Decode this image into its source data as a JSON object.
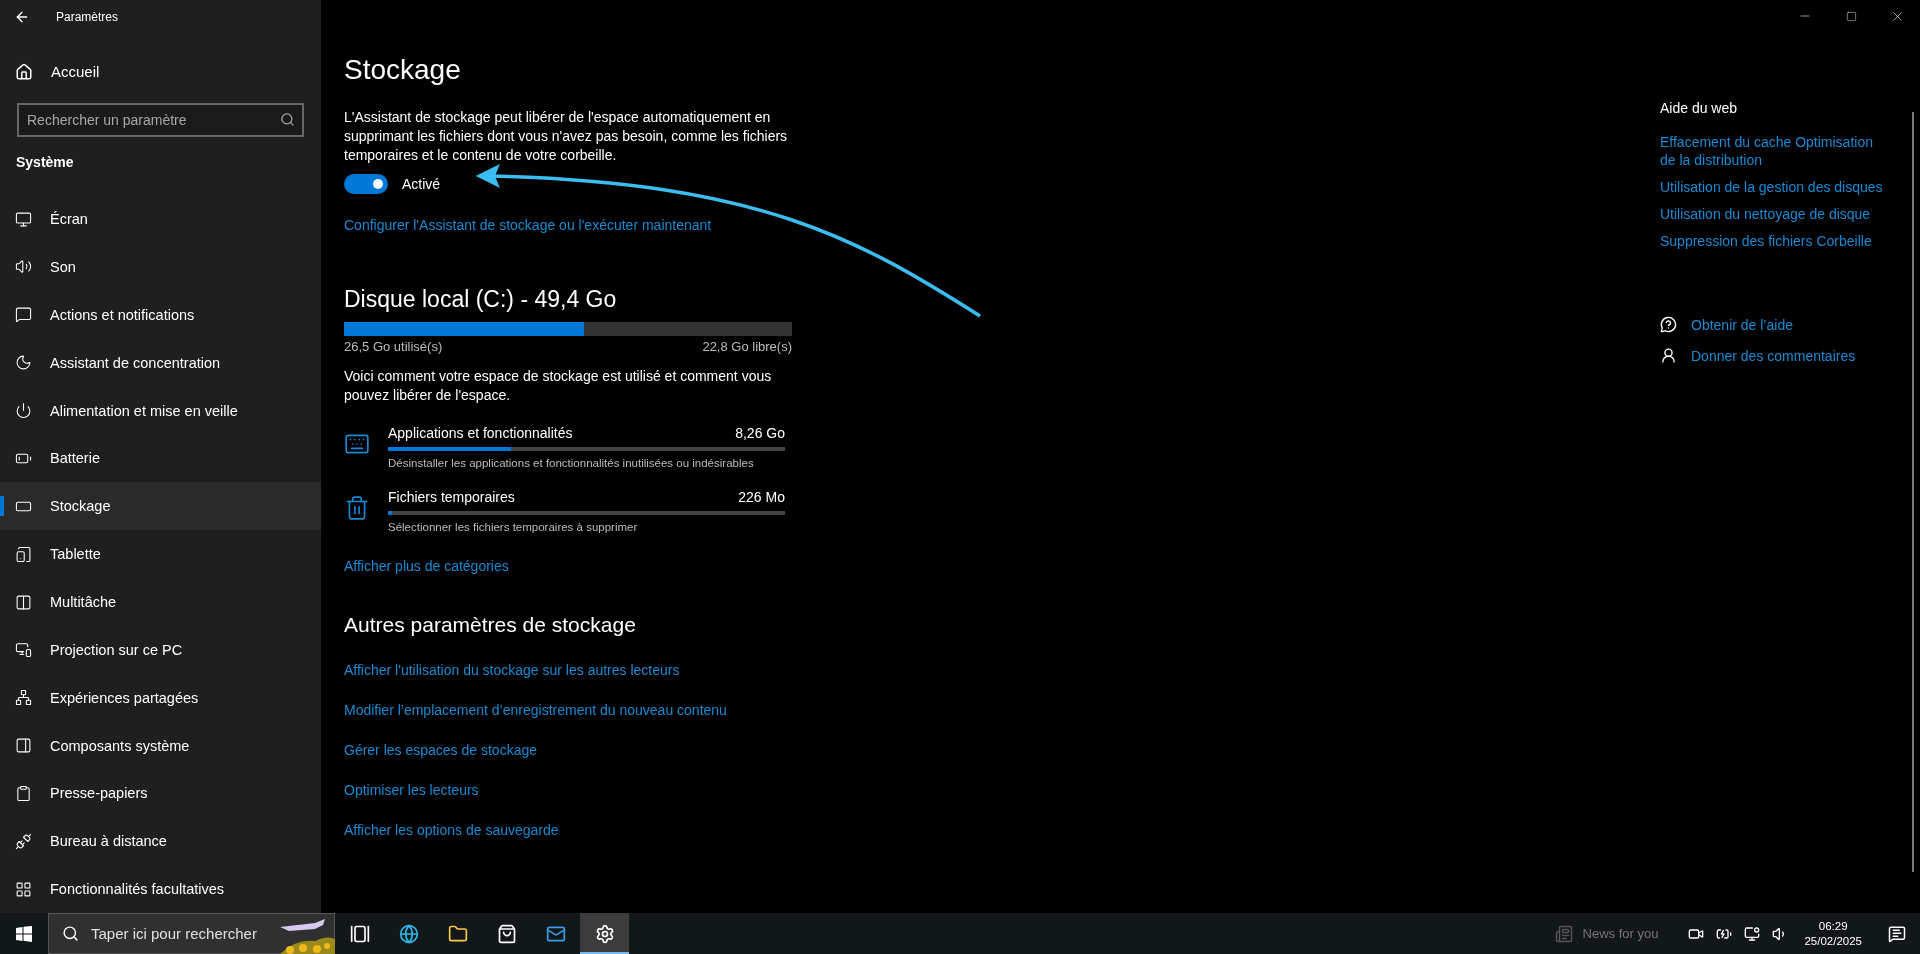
{
  "window": {
    "title": "Paramètres"
  },
  "sidebar": {
    "home": "Accueil",
    "search_placeholder": "Rechercher un paramètre",
    "section": "Système",
    "items": [
      {
        "label": "Écran",
        "selected": false
      },
      {
        "label": "Son",
        "selected": false
      },
      {
        "label": "Actions et notifications",
        "selected": false
      },
      {
        "label": "Assistant de concentration",
        "selected": false
      },
      {
        "label": "Alimentation et mise en veille",
        "selected": false
      },
      {
        "label": "Batterie",
        "selected": false
      },
      {
        "label": "Stockage",
        "selected": true
      },
      {
        "label": "Tablette",
        "selected": false
      },
      {
        "label": "Multitâche",
        "selected": false
      },
      {
        "label": "Projection sur ce PC",
        "selected": false
      },
      {
        "label": "Expériences partagées",
        "selected": false
      },
      {
        "label": "Composants système",
        "selected": false
      },
      {
        "label": "Presse-papiers",
        "selected": false
      },
      {
        "label": "Bureau à distance",
        "selected": false
      },
      {
        "label": "Fonctionnalités facultatives",
        "selected": false
      }
    ]
  },
  "main": {
    "title": "Stockage",
    "description": "L'Assistant de stockage peut libérer de l'espace automatiquement en supprimant les fichiers dont vous n'avez pas besoin, comme les fichiers temporaires et le contenu de votre corbeille.",
    "toggle": {
      "on": true,
      "label": "Activé"
    },
    "configure_link": "Configurer l'Assistant de stockage ou l'exécuter maintenant",
    "disk": {
      "title": "Disque local (C:) - 49,4 Go",
      "level": 0.536,
      "used": "26,5 Go utilisé(s)",
      "free": "22,8 Go libre(s)"
    },
    "intro": "Voici comment votre espace de stockage est utilisé et comment vous pouvez libérer de l'espace.",
    "categories": [
      {
        "kind": "apps",
        "name": "Applications et fonctionnalités",
        "size": "8,26 Go",
        "level": 0.31,
        "hint": "Désinstaller les applications et fonctionnalités inutilisées ou indésirables"
      },
      {
        "kind": "temp",
        "name": "Fichiers temporaires",
        "size": "226 Mo",
        "level": 0.008,
        "hint": "Sélectionner les fichiers temporaires à supprimer"
      }
    ],
    "more_link": "Afficher plus de catégories",
    "other_title": "Autres paramètres de stockage",
    "other_links": [
      "Afficher l'utilisation du stockage sur les autres lecteurs",
      "Modifier l’emplacement d’enregistrement du nouveau contenu",
      "Gérer les espaces de stockage",
      "Optimiser les lecteurs",
      "Afficher les options de sauvegarde"
    ]
  },
  "help": {
    "title": "Aide du web",
    "links": [
      "Effacement du cache Optimisation de la distribution",
      "Utilisation de la gestion des disques",
      "Utilisation du nettoyage de disque",
      "Suppression des fichiers Corbeille"
    ],
    "actions": [
      {
        "kind": "help",
        "label": "Obtenir de l’aide"
      },
      {
        "kind": "feedback",
        "label": "Donner des commentaires"
      }
    ]
  },
  "taskbar": {
    "search_placeholder": "Taper ici pour rechercher",
    "apps": [
      {
        "kind": "taskview",
        "selected": false
      },
      {
        "kind": "browser",
        "selected": false
      },
      {
        "kind": "folder",
        "selected": false
      },
      {
        "kind": "store",
        "selected": false
      },
      {
        "kind": "mail",
        "selected": false
      },
      {
        "kind": "settings",
        "selected": true
      }
    ],
    "news": "News for you",
    "time": "06:29",
    "date": "25/02/2025"
  }
}
